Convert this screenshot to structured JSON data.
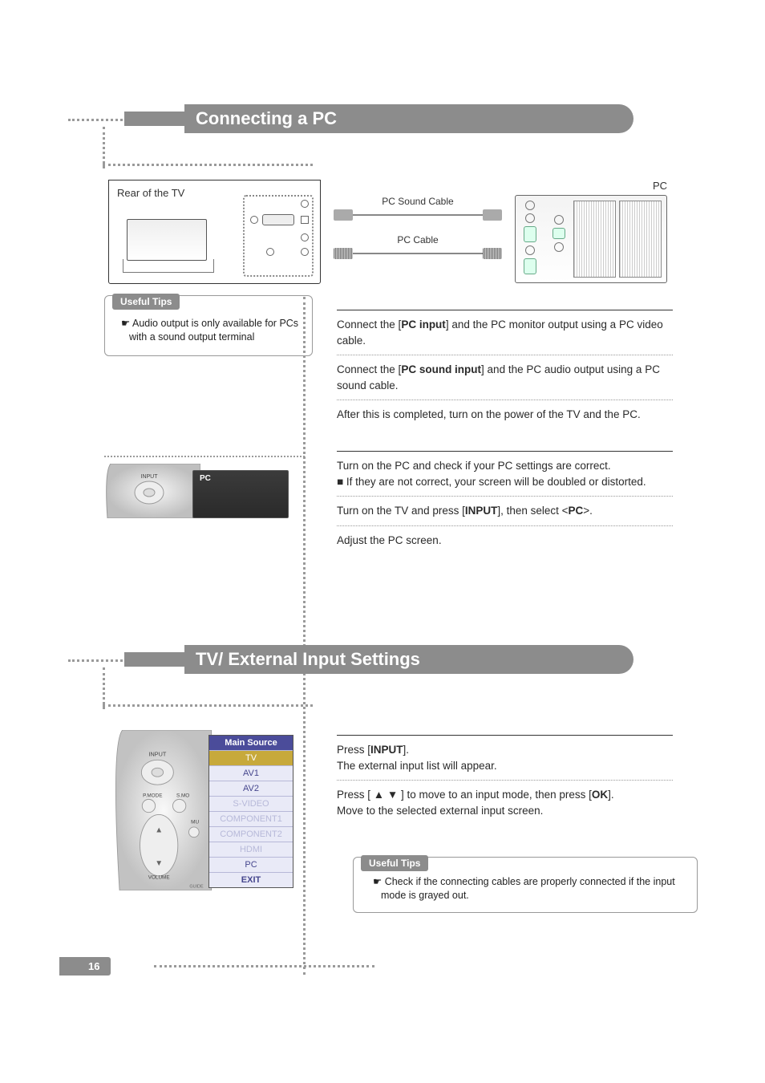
{
  "page_number": "16",
  "section1": {
    "title": "Connecting a PC",
    "rear_label": "Rear of the TV",
    "pc_label": "PC",
    "cable1": "PC Sound Cable",
    "cable2": "PC Cable",
    "tips_label": "Useful Tips",
    "tip1": "Audio output is only available for PCs with a sound output terminal",
    "steps_a": {
      "s1_pre": "Connect the [",
      "s1_bold": "PC input",
      "s1_post": "] and the PC monitor output using a PC video cable.",
      "s2_pre": "Connect the [",
      "s2_bold": "PC sound input",
      "s2_post": "] and the PC audio output using a PC sound cable.",
      "s3": "After this is completed, turn on the power of the TV and the PC."
    },
    "screen_tag": "PC",
    "remote_label": "INPUT",
    "steps_b": {
      "s1": "Turn on the PC and check if your PC settings are correct.",
      "s1b": "If they are not correct, your screen will be doubled or distorted.",
      "s2_pre": "Turn on the TV and press [",
      "s2_b1": "INPUT",
      "s2_mid": "], then select <",
      "s2_b2": "PC",
      "s2_post": ">.",
      "s3": "Adjust the PC screen."
    }
  },
  "section2": {
    "title": "TV/ External Input Settings",
    "menu": {
      "title": "Main Source",
      "items": [
        "TV",
        "AV1",
        "AV2",
        "S-VIDEO",
        "COMPONENT1",
        "COMPONENT2",
        "HDMI",
        "PC",
        "EXIT"
      ],
      "disabled": [
        "S-VIDEO",
        "COMPONENT1",
        "COMPONENT2",
        "HDMI"
      ],
      "selected": "TV"
    },
    "remote_labels": {
      "input": "INPUT",
      "pmode": "P.MODE",
      "smode": "S.MO",
      "mu": "MU",
      "volume": "VOLUME",
      "guide": "GUIDE"
    },
    "steps": {
      "s1_pre": "Press [",
      "s1_bold": "INPUT",
      "s1_post": "].",
      "s1b": "The external input list will appear.",
      "s2_pre": "Press [ ",
      "s2_sym": "▲ ▼",
      "s2_mid": " ] to move to an input mode, then press [",
      "s2_bold": "OK",
      "s2_post": "].",
      "s2b": "Move to the selected external input screen."
    },
    "tips_label": "Useful Tips",
    "tip1": "Check if the connecting cables are properly connected if the input mode is grayed out."
  }
}
